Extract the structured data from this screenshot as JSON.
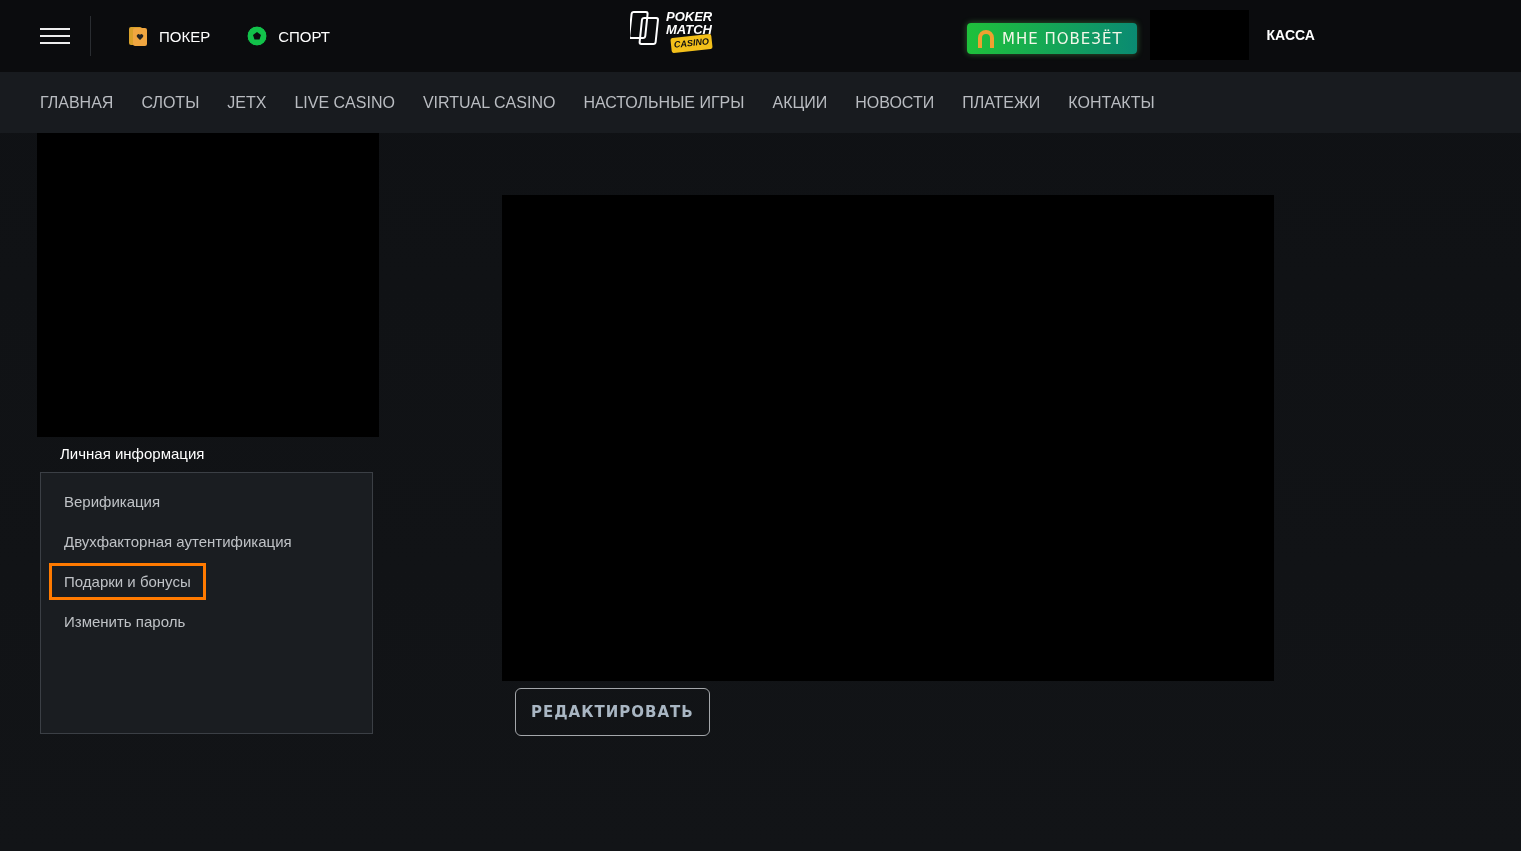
{
  "header": {
    "quick_links": [
      {
        "label": "ПОКЕР",
        "kind": "cards"
      },
      {
        "label": "СПОРТ",
        "kind": "ball"
      }
    ],
    "logo": {
      "line_1": "POKER",
      "line_2": "MATCH",
      "badge": "CASINO"
    },
    "lucky_button": "МНЕ ПОВЕЗЁТ",
    "cashier": "КАССА"
  },
  "nav": [
    {
      "label": "ГЛАВНАЯ"
    },
    {
      "label": "СЛОТЫ"
    },
    {
      "label": "JETX"
    },
    {
      "label": "LIVE CASINO"
    },
    {
      "label": "VIRTUAL CASINO"
    },
    {
      "label": "НАСТОЛЬНЫЕ ИГРЫ"
    },
    {
      "label": "АКЦИИ"
    },
    {
      "label": "НОВОСТИ"
    },
    {
      "label": "ПЛАТЕЖИ"
    },
    {
      "label": "КОНТАКТЫ"
    }
  ],
  "sidebar": {
    "title": "Личная информация",
    "items": [
      {
        "label": "Верификация",
        "highlighted": false
      },
      {
        "label": "Двухфакторная аутентификация",
        "highlighted": false
      },
      {
        "label": "Подарки и бонусы",
        "highlighted": true
      },
      {
        "label": "Изменить пароль",
        "highlighted": false
      }
    ]
  },
  "main": {
    "edit_button": "РЕДАКТИРОВАТЬ"
  }
}
